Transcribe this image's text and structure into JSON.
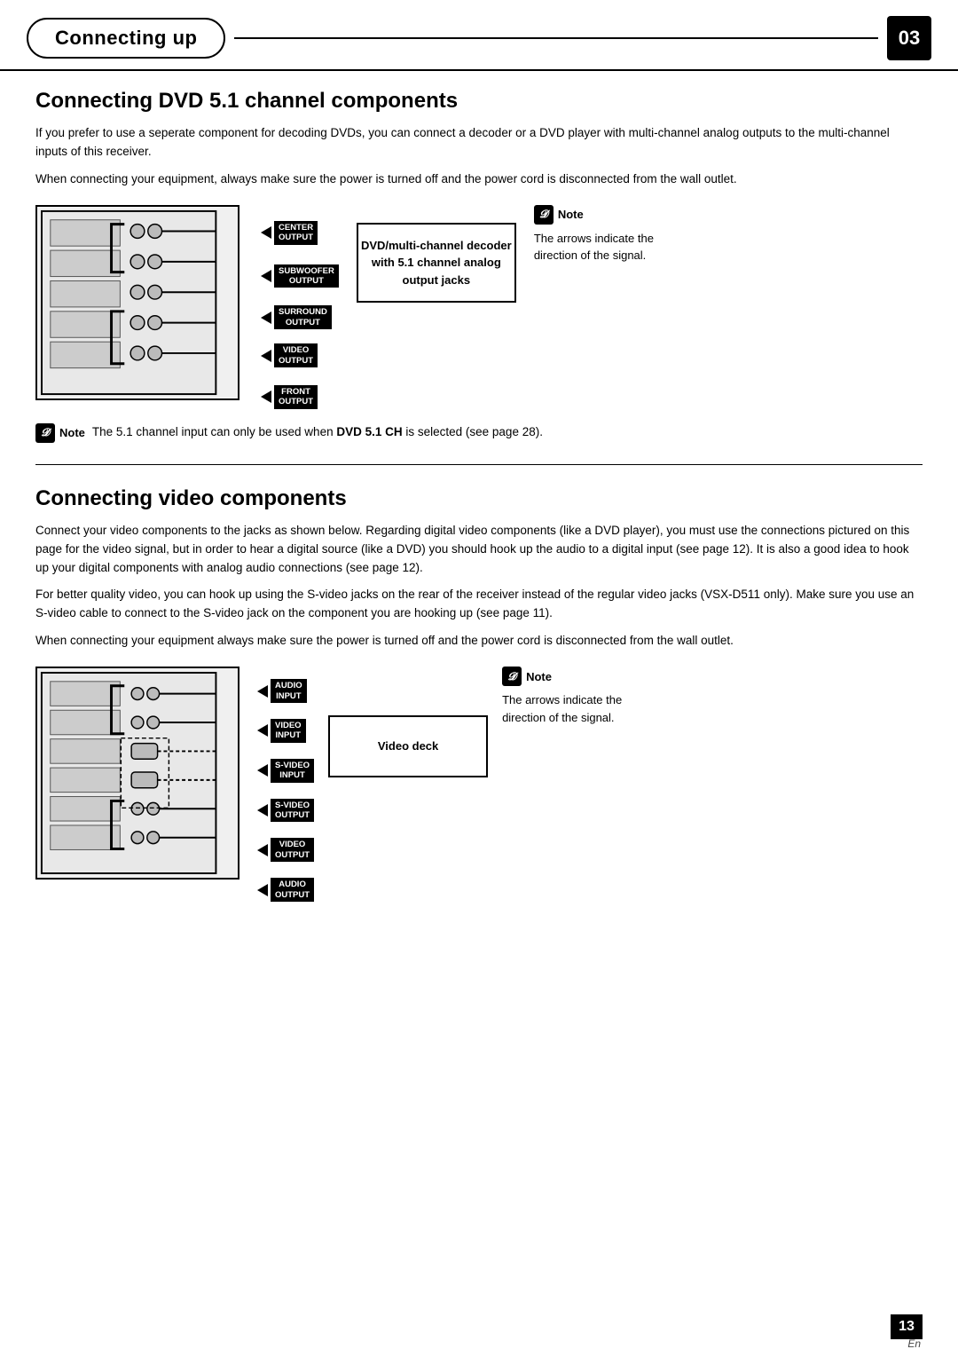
{
  "header": {
    "title": "Connecting up",
    "page_number": "03"
  },
  "section1": {
    "title": "Connecting DVD 5.1 channel components",
    "body1": "If you prefer to use a seperate component for decoding DVDs, you can connect a decoder or a DVD player with multi-channel analog outputs to the multi-channel inputs of this receiver.",
    "body2": "When connecting your equipment, always make sure the power is turned off and the power cord is disconnected from the wall outlet.",
    "diagram_labels": [
      {
        "line1": "CENTER",
        "line2": "OUTPUT"
      },
      {
        "line1": "SUBWOOFER",
        "line2": "OUTPUT"
      },
      {
        "line1": "SURROUND",
        "line2": "OUTPUT"
      },
      {
        "line1": "VIDEO",
        "line2": "OUTPUT"
      },
      {
        "line1": "FRONT",
        "line2": "OUTPUT"
      }
    ],
    "decoder_label": "DVD/multi-channel decoder\nwith 5.1 channel analog\noutput jacks",
    "note_header": "Note",
    "note_text": "The arrows indicate the direction of the signal.",
    "note_block_label": "Note",
    "note_block_text": "The 5.1 channel input can only be used when ",
    "note_block_bold": "DVD 5.1 CH",
    "note_block_text2": " is selected (see page 28)."
  },
  "section2": {
    "title": "Connecting video components",
    "body1": "Connect your video components to the jacks as shown below. Regarding digital video components (like a DVD player), you must use the connections pictured on this page for the video signal, but in order to hear a digital source (like a DVD) you should hook up the audio to a digital input (see page 12). It is also a good idea to hook up your digital components with analog audio connections (see page 12).",
    "body2": "For better quality video, you can hook up using the S-video jacks on the rear of the receiver instead of the regular video jacks (VSX-D511 only). Make sure you use an S-video cable to connect to the S-video jack on the component you are hooking up (see page 11).",
    "body3": "When connecting your equipment always make sure the power is turned off and the power cord is disconnected from the wall outlet.",
    "diagram_labels": [
      {
        "line1": "AUDIO",
        "line2": "INPUT"
      },
      {
        "line1": "VIDEO",
        "line2": "INPUT"
      },
      {
        "line1": "S-VIDEO",
        "line2": "INPUT"
      },
      {
        "line1": "S-VIDEO",
        "line2": "OUTPUT"
      },
      {
        "line1": "VIDEO",
        "line2": "OUTPUT"
      },
      {
        "line1": "AUDIO",
        "line2": "OUTPUT"
      }
    ],
    "deck_label": "Video deck",
    "note_header": "Note",
    "note_text": "The arrows indicate the direction of the signal."
  },
  "page_number": "13",
  "en_label": "En"
}
